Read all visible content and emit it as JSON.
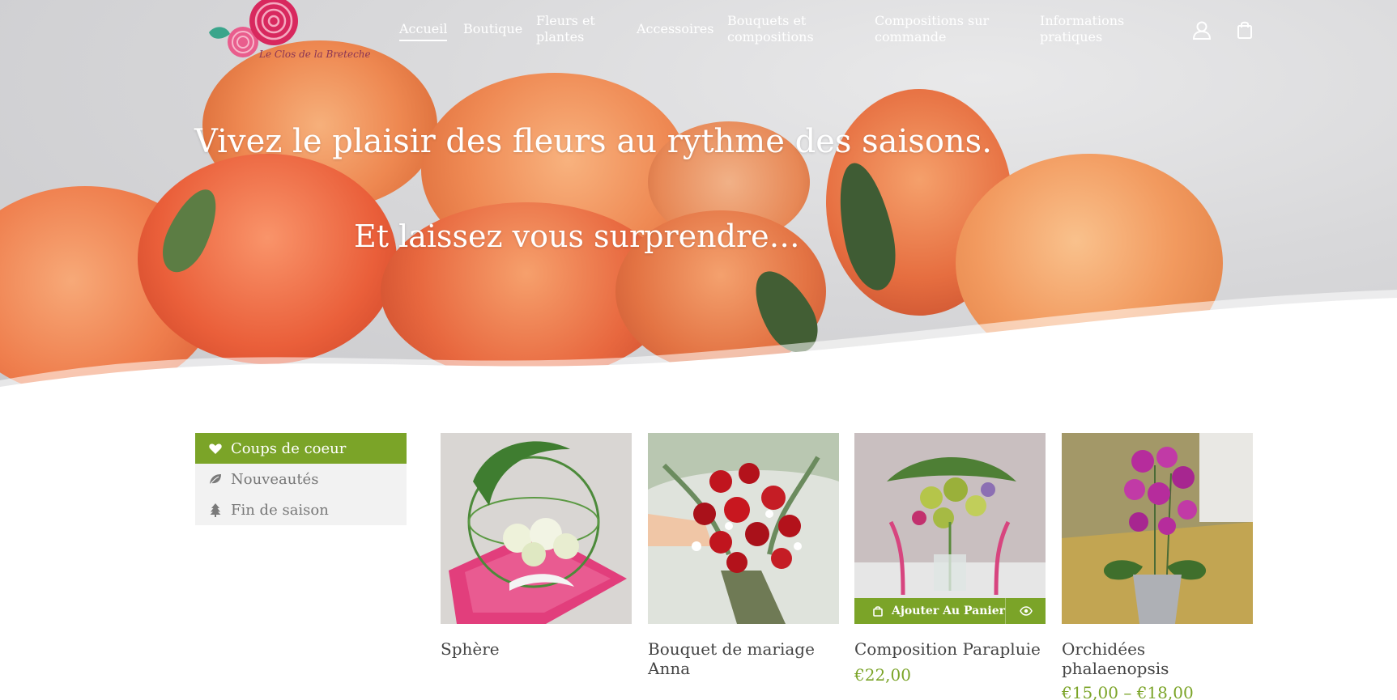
{
  "brand": {
    "logo_text": "Le Clos de la Breteche"
  },
  "nav": {
    "items": [
      {
        "label": "Accueil"
      },
      {
        "label": "Boutique"
      },
      {
        "label": "Fleurs et\nplantes"
      },
      {
        "label": "Accessoires"
      },
      {
        "label": "Bouquets et\ncompositions"
      },
      {
        "label": "Compositions sur\ncommande"
      },
      {
        "label": "Informations\npratiques"
      }
    ],
    "icons": [
      "account-icon",
      "shopping-bag-icon"
    ]
  },
  "hero": {
    "title": "Vivez le plaisir des fleurs au rythme des saisons.",
    "subtitle": "Et laissez vous surprendre…"
  },
  "filters": [
    {
      "label": "Coups de coeur",
      "icon": "heart-icon",
      "active": true
    },
    {
      "label": "Nouveautés",
      "icon": "leaf-icon",
      "active": false
    },
    {
      "label": "Fin de saison",
      "icon": "tree-icon",
      "active": false
    }
  ],
  "products": [
    {
      "name": "Sphère",
      "price": ""
    },
    {
      "name": "Bouquet de mariage Anna",
      "price": ""
    },
    {
      "name": "Composition Parapluie",
      "price": "€22,00",
      "add_to_cart": "Ajouter Au Panier"
    },
    {
      "name": "Orchidées phalaenopsis",
      "price": "€15,00 – €18,00"
    }
  ],
  "colors": {
    "accent": "#7ba428",
    "active_tab_bg": "#7ba428",
    "tab_bg": "#f2f2f2",
    "price": "#7ba428"
  }
}
